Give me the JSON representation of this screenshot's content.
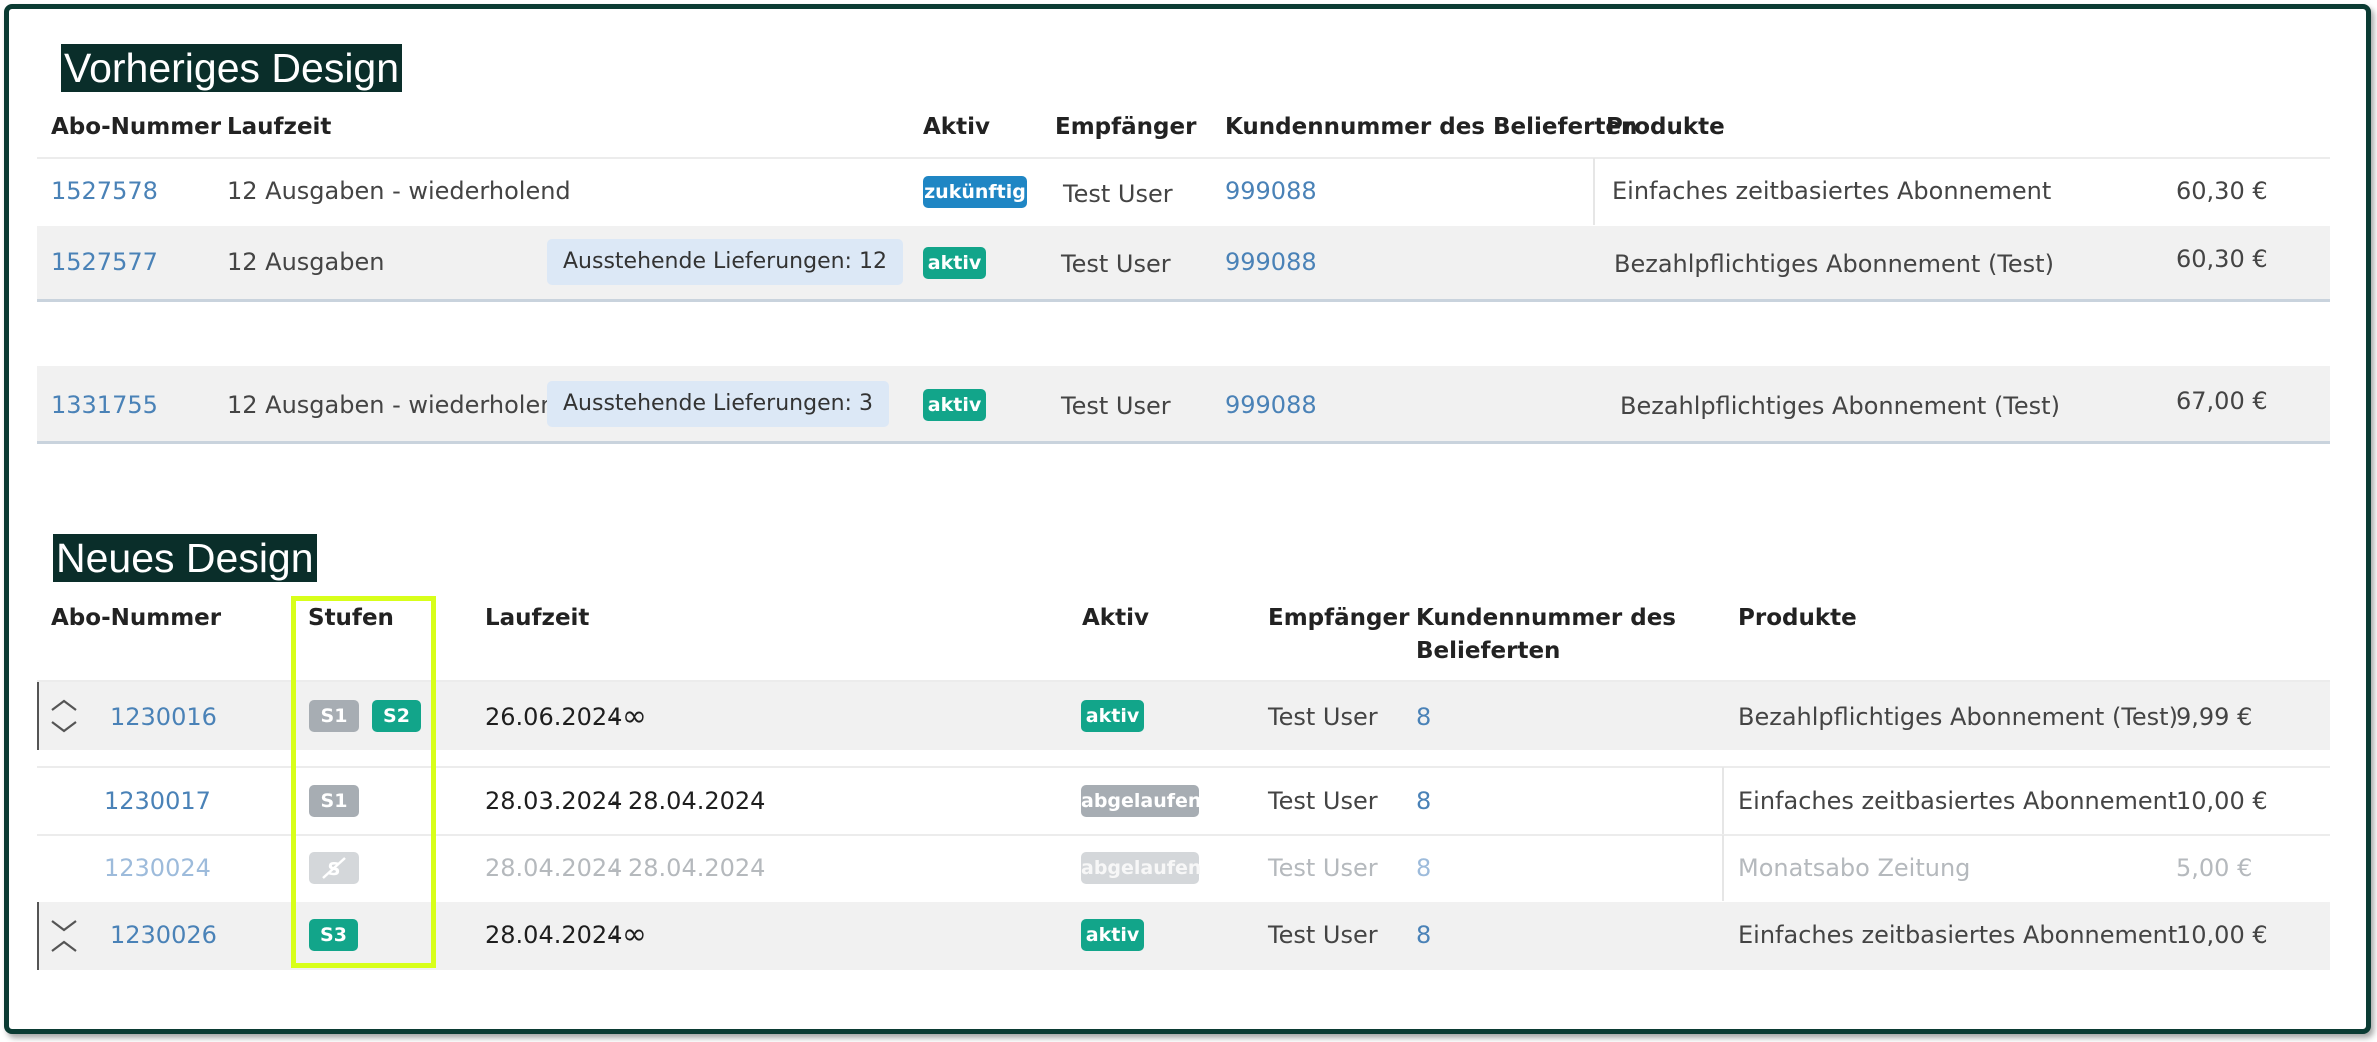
{
  "old_design": {
    "heading": "Vorheriges Design",
    "columns": {
      "abo_nummer": "Abo-Nummer",
      "laufzeit": "Laufzeit",
      "aktiv": "Aktiv",
      "empfaenger": "Empfänger",
      "kundennummer": "Kundennummer des Belieferten",
      "produkte": "Produkte"
    },
    "rows": [
      {
        "abo_nummer": "1527578",
        "laufzeit": "12 Ausgaben - wiederholend",
        "pending": "",
        "status": "zukünftig",
        "empfaenger": "Test User",
        "kundennummer": "999088",
        "produkt": "Einfaches zeitbasiertes Abonnement",
        "preis": "60,30 €"
      },
      {
        "abo_nummer": "1527577",
        "laufzeit": "12 Ausgaben",
        "pending": "Ausstehende Lieferungen: 12",
        "status": "aktiv",
        "empfaenger": "Test User",
        "kundennummer": "999088",
        "produkt": "Bezahlpflichtiges Abonnement (Test)",
        "preis": "60,30 €"
      },
      {
        "abo_nummer": "1331755",
        "laufzeit": "12 Ausgaben - wiederholend",
        "pending": "Ausstehende Lieferungen: 3",
        "status": "aktiv",
        "empfaenger": "Test User",
        "kundennummer": "999088",
        "produkt": "Bezahlpflichtiges Abonnement (Test)",
        "preis": "67,00 €"
      }
    ]
  },
  "new_design": {
    "heading": "Neues Design",
    "columns": {
      "abo_nummer": "Abo-Nummer",
      "stufen": "Stufen",
      "laufzeit": "Laufzeit",
      "aktiv": "Aktiv",
      "empfaenger": "Empfänger",
      "kundennummer_line1": "Kundennummer des",
      "kundennummer_line2": "Belieferten",
      "produkte": "Produkte"
    },
    "rows": [
      {
        "abo_nummer": "1230016",
        "stufen": [
          "S1",
          "S2"
        ],
        "start": "26.06.2024",
        "separator": "-",
        "end": "∞",
        "status": "aktiv",
        "empfaenger": "Test User",
        "kundennummer": "8",
        "produkt": "Bezahlpflichtiges Abonnement (Test)",
        "preis": "9,99 €",
        "toggle_icon": "chevron-up-down-icon"
      },
      {
        "abo_nummer": "1230017",
        "stufen": [
          "S1"
        ],
        "start": "28.03.2024",
        "separator": "-",
        "end": "28.04.2024",
        "status": "abgelaufen",
        "empfaenger": "Test User",
        "kundennummer": "8",
        "produkt": "Einfaches zeitbasiertes Abonnement",
        "preis": "10,00 €"
      },
      {
        "abo_nummer": "1230024",
        "stufen": [],
        "stufe_icon": "no-stage-icon",
        "start": "28.04.2024",
        "separator": "-",
        "end": "28.04.2024",
        "status": "abgelaufen",
        "empfaenger": "Test User",
        "kundennummer": "8",
        "produkt": "Monatsabo Zeitung",
        "preis": "5,00 €"
      },
      {
        "abo_nummer": "1230026",
        "stufen": [
          "S3"
        ],
        "start": "28.04.2024",
        "separator": "-",
        "end": "∞",
        "status": "aktiv",
        "empfaenger": "Test User",
        "kundennummer": "8",
        "produkt": "Einfaches zeitbasiertes Abonnement",
        "preis": "10,00 €",
        "toggle_icon": "chevron-down-up-icon"
      }
    ]
  },
  "colors": {
    "frame": "#0b3b33",
    "heading_bg": "#0a2e2a",
    "link": "#4a82b7",
    "badge_active": "#12a58a",
    "badge_future": "#1f86c4",
    "badge_expired": "#a7adb3",
    "highlight_box": "#d8ff1a"
  }
}
